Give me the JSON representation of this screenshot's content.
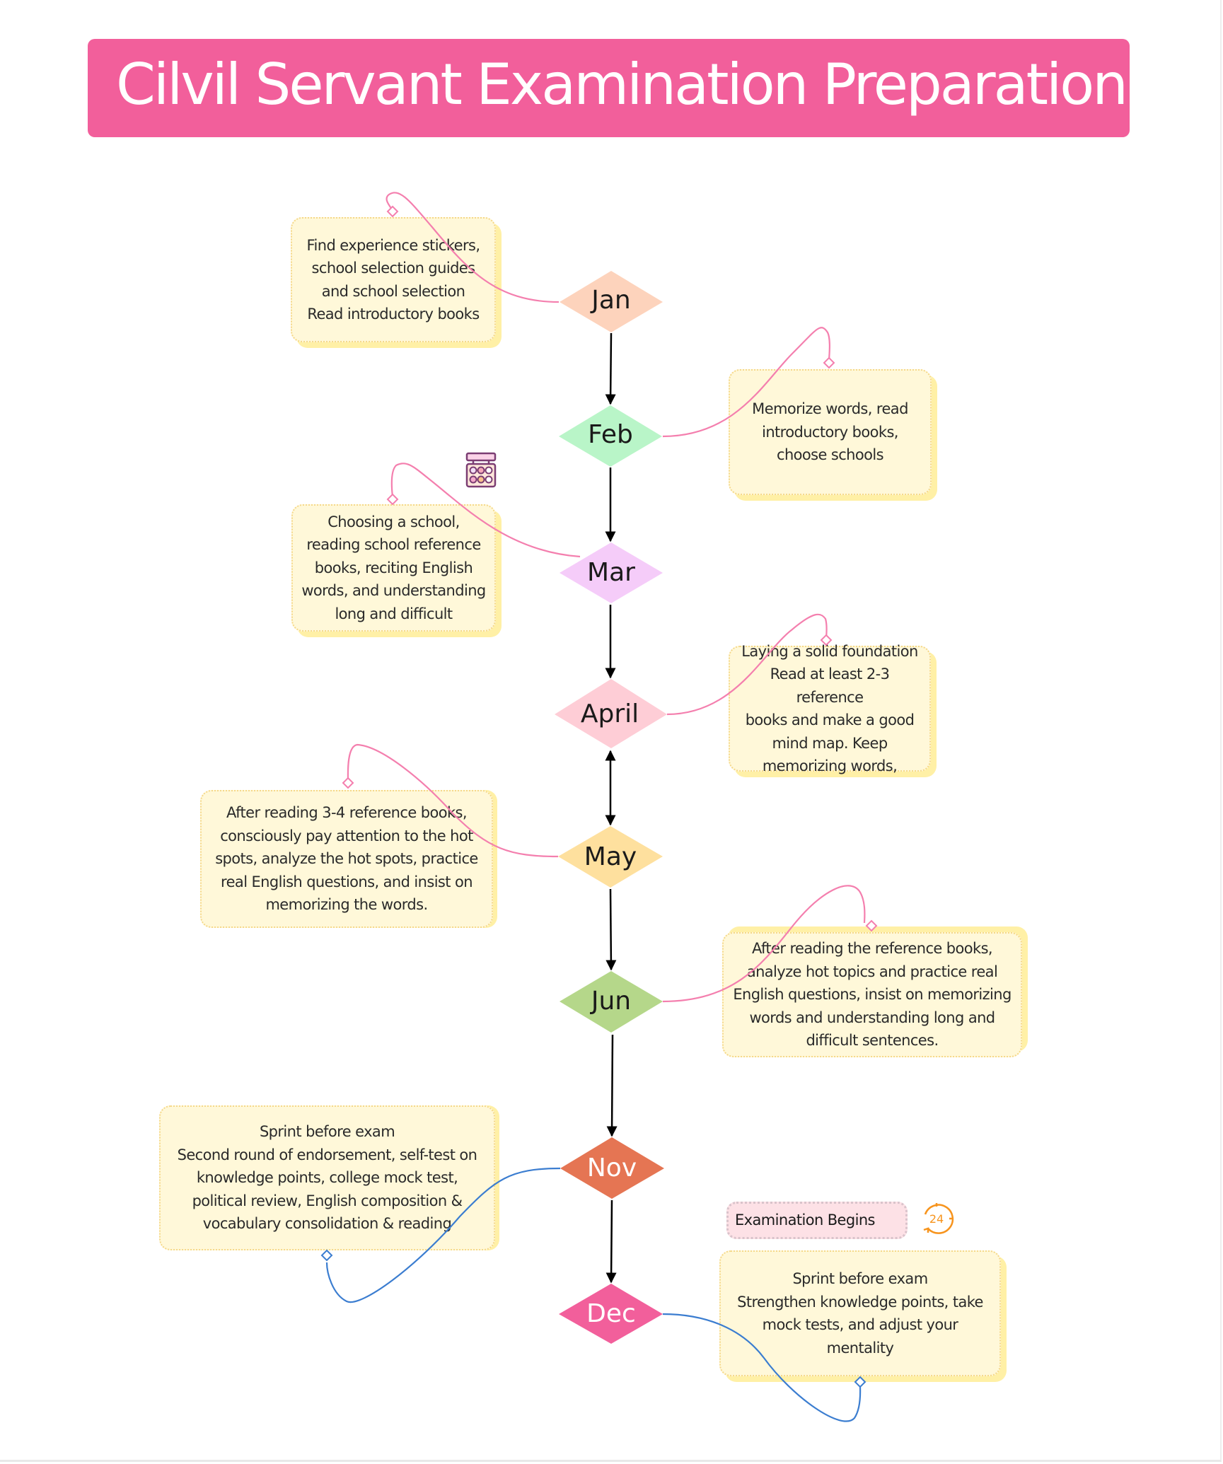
{
  "title": "Cilvil Servant Examination Preparation",
  "colors": {
    "title_bg": "#F25F9B",
    "note_bg": "#FFF8D9",
    "note_shadow": "#FFF0A6",
    "connector_pink": "#F47FAE",
    "connector_blue": "#3B7DD0",
    "arrow": "#000000",
    "clock_icon": "#F7941D"
  },
  "months": [
    {
      "label": "Jan",
      "color": "#FDD3BC",
      "text_color": "#1a1a1a"
    },
    {
      "label": "Feb",
      "color": "#B9F5C8",
      "text_color": "#1a1a1a"
    },
    {
      "label": "Mar",
      "color": "#F5CCF9",
      "text_color": "#1a1a1a"
    },
    {
      "label": "April",
      "color": "#FECDD6",
      "text_color": "#1a1a1a"
    },
    {
      "label": "May",
      "color": "#FEE09E",
      "text_color": "#1a1a1a"
    },
    {
      "label": "Jun",
      "color": "#B5D78A",
      "text_color": "#1a1a1a"
    },
    {
      "label": "Nov",
      "color": "#E57553",
      "text_color": "#ffffff"
    },
    {
      "label": "Dec",
      "color": "#F25F9B",
      "text_color": "#ffffff"
    }
  ],
  "notes": [
    {
      "month": "Jan",
      "text": "Find experience stickers,\nschool selection guides\nand school selection\nRead introductory books"
    },
    {
      "month": "Feb",
      "text": "Memorize words, read\nintroductory books,\nchoose schools"
    },
    {
      "month": "Mar",
      "text": "Choosing a school,\nreading school reference\nbooks, reciting English\nwords, and understanding\nlong and difficult"
    },
    {
      "month": "April",
      "text": "Laying a solid foundation\nRead at least 2-3 reference\nbooks and make a good\nmind map. Keep\nmemorizing words,"
    },
    {
      "month": "May",
      "text": "After reading 3-4 reference books,\nconsciously pay attention to the hot\nspots, analyze the hot spots, practice\nreal English questions, and insist on\nmemorizing the words."
    },
    {
      "month": "Jun",
      "text": "After reading the reference books,\nanalyze hot topics and practice real\nEnglish questions, insist on memorizing\nwords and understanding long and\ndifficult sentences."
    },
    {
      "month": "Nov",
      "text": "Sprint before exam\nSecond round of endorsement, self-test on\nknowledge points, college mock test,\npolitical review, English composition &\nvocabulary consolidation & reading"
    },
    {
      "month": "Dec",
      "text": "Sprint before exam\nStrengthen knowledge points, take\nmock tests, and adjust your mentality"
    }
  ],
  "exam_label": "Examination Begins",
  "icons": {
    "palette": "eyeshadow-palette-icon",
    "clock": "24-hour-clock-icon",
    "clock_text": "24"
  }
}
